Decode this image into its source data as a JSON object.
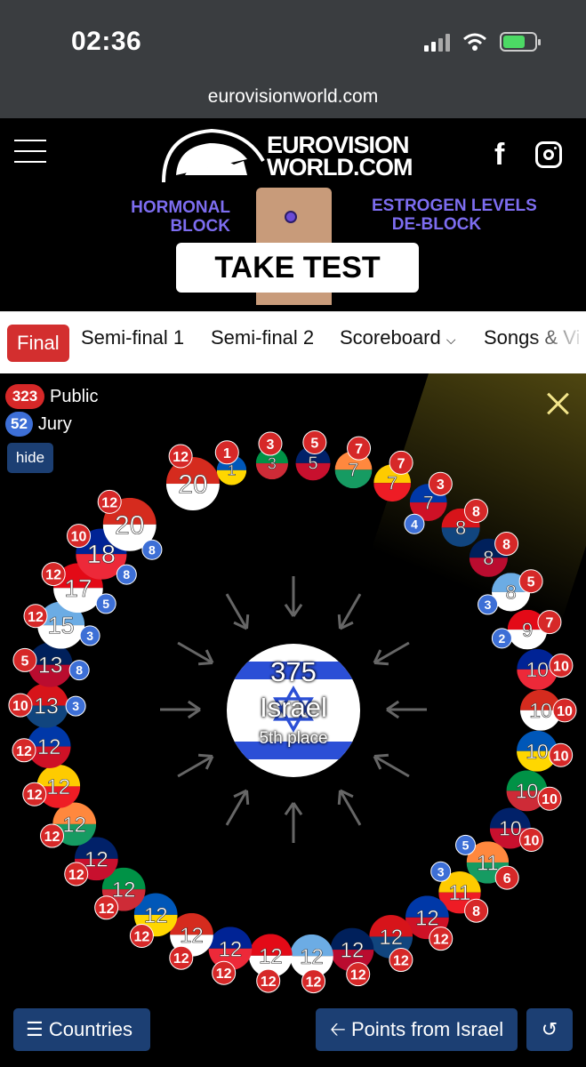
{
  "status": {
    "time": "02:36",
    "icons": [
      "signal-icon",
      "wifi-icon",
      "battery-charging-icon"
    ]
  },
  "browser": {
    "url": "eurovisionworld.com"
  },
  "header": {
    "logo_line1": "EUROVISION",
    "logo_line2": "WORLD.COM",
    "ad": {
      "left_text_1": "HORMONAL",
      "left_text_2": "BLOCK",
      "right_text_1": "ESTROGEN LEVELS",
      "right_text_2": "DE-BLOCK",
      "button": "TAKE TEST"
    }
  },
  "tabs": [
    {
      "label": "Final",
      "active": true
    },
    {
      "label": "Semi-final 1"
    },
    {
      "label": "Semi-final 2"
    },
    {
      "label": "Scoreboard"
    },
    {
      "label": "Songs & Vi"
    }
  ],
  "legend": {
    "public_value": "323",
    "public_label": "Public",
    "jury_value": "52",
    "jury_label": "Jury",
    "hide": "hide"
  },
  "center": {
    "score": "375",
    "country": "Israel",
    "place": "5th place"
  },
  "colors": {
    "public": "#d62828",
    "jury": "#3d6fd6",
    "button": "#1c3f73",
    "active_tab": "#d32f2f"
  },
  "ring": [
    {
      "total": "20",
      "public": "12"
    },
    {
      "total": "1",
      "public": "1"
    },
    {
      "total": "3",
      "public": "3"
    },
    {
      "total": "5",
      "public": "5"
    },
    {
      "total": "7",
      "public": "7"
    },
    {
      "total": "7",
      "public": "7"
    },
    {
      "total": "7",
      "public": "3",
      "jury": "4"
    },
    {
      "total": "8",
      "public": "8"
    },
    {
      "total": "8",
      "public": "8"
    },
    {
      "total": "8",
      "public": "5",
      "jury": "3"
    },
    {
      "total": "9",
      "public": "7",
      "jury": "2"
    },
    {
      "total": "10",
      "public": "10"
    },
    {
      "total": "10",
      "public": "10"
    },
    {
      "total": "10",
      "public": "10"
    },
    {
      "total": "10",
      "public": "10"
    },
    {
      "total": "10",
      "public": "10"
    },
    {
      "total": "11",
      "public": "6",
      "jury": "5"
    },
    {
      "total": "11",
      "public": "8",
      "jury": "3"
    },
    {
      "total": "12",
      "public": "12"
    },
    {
      "total": "12",
      "public": "12"
    },
    {
      "total": "12",
      "public": "12"
    },
    {
      "total": "12",
      "public": "12"
    },
    {
      "total": "12",
      "public": "12"
    },
    {
      "total": "12",
      "public": "12"
    },
    {
      "total": "12",
      "public": "12"
    },
    {
      "total": "12",
      "public": "12"
    },
    {
      "total": "12",
      "public": "12"
    },
    {
      "total": "12",
      "public": "12"
    },
    {
      "total": "12",
      "public": "12"
    },
    {
      "total": "12",
      "public": "12"
    },
    {
      "total": "12",
      "public": "12"
    },
    {
      "total": "13",
      "public": "10",
      "jury": "3"
    },
    {
      "total": "13",
      "public": "5",
      "jury": "8"
    },
    {
      "total": "15",
      "public": "12",
      "jury": "3"
    },
    {
      "total": "17",
      "public": "12",
      "jury": "5"
    },
    {
      "total": "18",
      "public": "10",
      "jury": "8"
    },
    {
      "total": "20",
      "public": "12",
      "jury": "8"
    }
  ],
  "bottom": {
    "countries": "Countries",
    "points_from": "Points from Israel"
  }
}
